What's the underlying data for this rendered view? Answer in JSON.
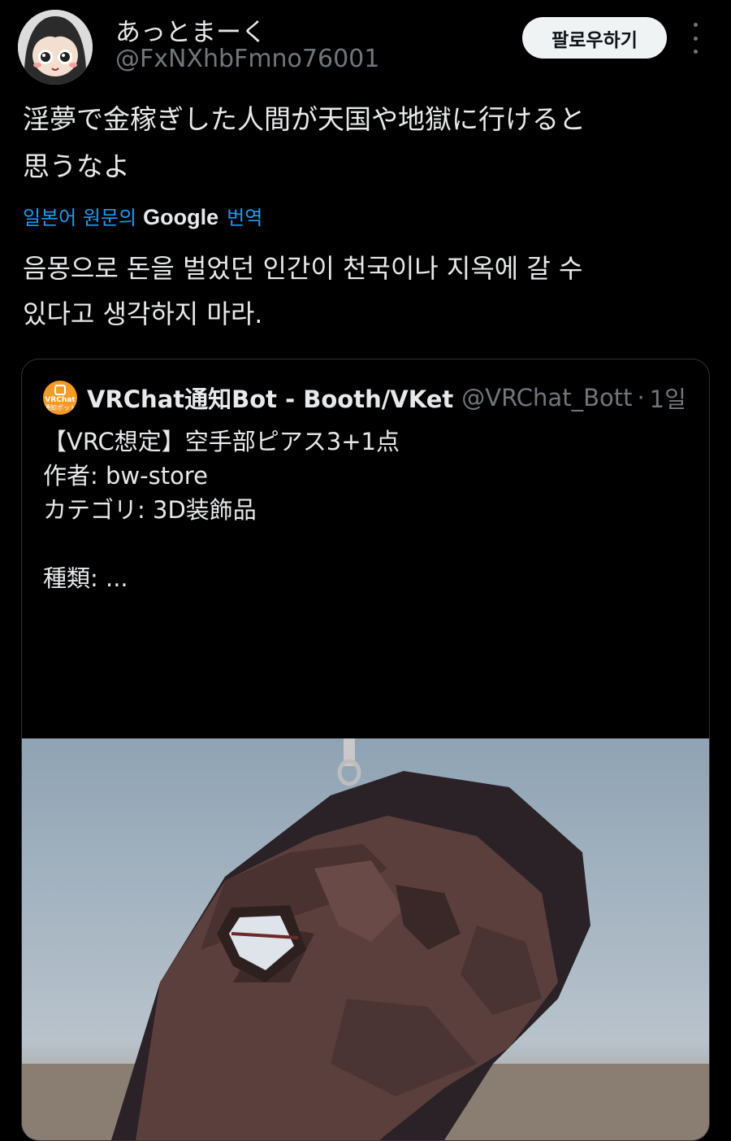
{
  "author": {
    "display_name": "あっとまーく",
    "handle": "@FxNXhbFmno76001",
    "avatar_icon": "anime-avatar"
  },
  "follow_button_label": "팔로우하기",
  "more_icon": "more-vertical-icon",
  "tweet": {
    "lines": [
      "淫夢で金稼ぎした人間が天国や地獄に行けると",
      "思うなよ"
    ]
  },
  "translation": {
    "prefix": "일본어 원문의",
    "google": "Google",
    "suffix": "번역",
    "lines": [
      "음몽으로 돈을 벌었던 인간이 천국이나 지옥에 갈 수",
      "있다고 생각하지 마라."
    ]
  },
  "quote": {
    "avatar_label_1": "VRChat",
    "avatar_label_2": "通知ボット",
    "name": "VRChat通知Bot - Booth/VKet",
    "handle": "@VRChat_Bott",
    "separator": "·",
    "time": "1일",
    "body_lines": [
      "【VRC想定】空手部ピアス3+1点",
      "作者: bw-store",
      "カテゴリ: 3D装飾品",
      "",
      "種類: ..."
    ],
    "media_icon": "low-poly-head-render"
  },
  "colors": {
    "background": "#000000",
    "text": "#e7e9ea",
    "secondary": "#71767b",
    "link": "#1d9bf0",
    "border": "#2f3336"
  }
}
